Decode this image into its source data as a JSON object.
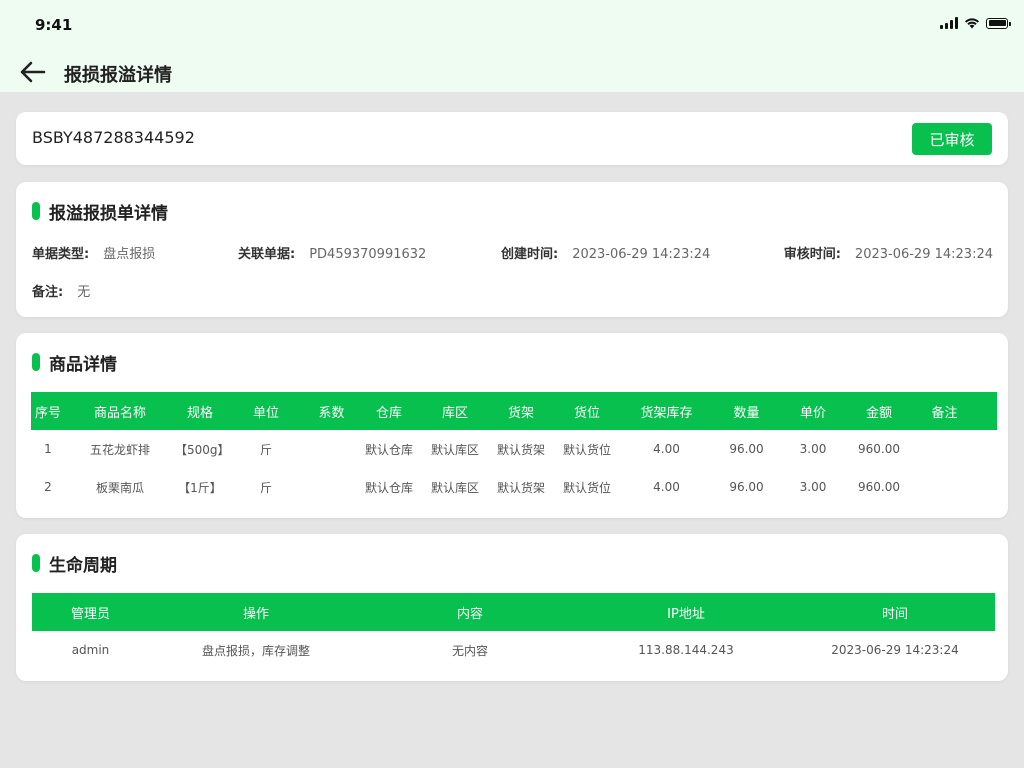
{
  "status_bar": {
    "time": "9:41"
  },
  "nav": {
    "title": "报损报溢详情"
  },
  "order": {
    "number": "BSBY487288344592",
    "status": "已审核"
  },
  "detail_section": {
    "title": "报溢报损单详情",
    "fields": [
      {
        "label": "单据类型:",
        "value": "盘点报损"
      },
      {
        "label": "关联单据:",
        "value": "PD459370991632"
      },
      {
        "label": "创建时间:",
        "value": "2023-06-29  14:23:24"
      },
      {
        "label": "审核时间:",
        "value": "2023-06-29  14:23:24"
      },
      {
        "label": "备注:",
        "value": "无"
      }
    ]
  },
  "goods_section": {
    "title": "商品详情",
    "columns": [
      "序号",
      "商品名称",
      "规格",
      "单位",
      "系数",
      "仓库",
      "库区",
      "货架",
      "货位",
      "货架库存",
      "数量",
      "单价",
      "金额",
      "备注"
    ],
    "rows": [
      [
        "1",
        "五花龙虾排",
        "【500g】",
        "斤",
        "",
        "默认仓库",
        "默认库区",
        "默认货架",
        "默认货位",
        "4.00",
        "96.00",
        "3.00",
        "960.00",
        ""
      ],
      [
        "2",
        "板栗南瓜",
        "【1斤】",
        "斤",
        "",
        "默认仓库",
        "默认库区",
        "默认货架",
        "默认货位",
        "4.00",
        "96.00",
        "3.00",
        "960.00",
        ""
      ]
    ]
  },
  "life_section": {
    "title": "生命周期",
    "columns": [
      "管理员",
      "操作",
      "内容",
      "IP地址",
      "时间"
    ],
    "rows": [
      [
        "admin",
        "盘点报损，库存调整",
        "无内容",
        "113.88.144.243",
        "2023-06-29  14:23:24"
      ]
    ]
  },
  "colors": {
    "accent": "#07c04e",
    "header_bg": "#effcf2",
    "page_bg": "#e5e5e5"
  }
}
